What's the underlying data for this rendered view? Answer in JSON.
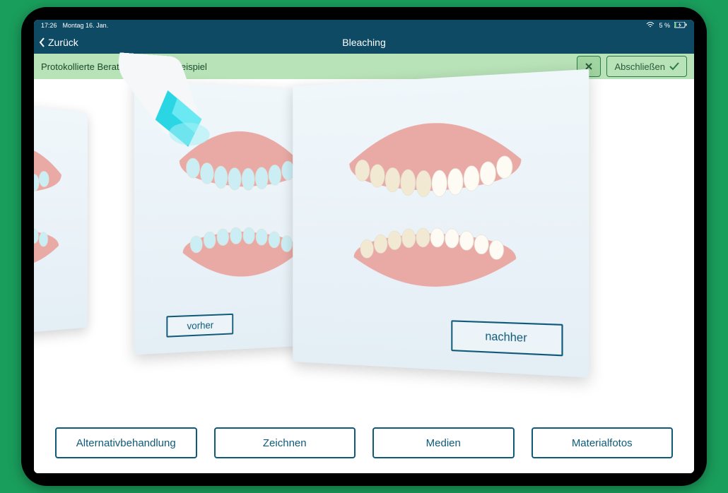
{
  "status": {
    "time": "17:26",
    "date": "Montag 16. Jan.",
    "battery": "5 %"
  },
  "nav": {
    "back": "Zurück",
    "title": "Bleaching"
  },
  "consult": {
    "text": "Protokollierte Beratung für Peter Beispiel",
    "finish": "Abschließen"
  },
  "cards": {
    "before": "vorher",
    "after": "nachher"
  },
  "buttons": {
    "alt": "Alternativbehandlung",
    "draw": "Zeichnen",
    "media": "Medien",
    "material": "Materialfotos"
  }
}
